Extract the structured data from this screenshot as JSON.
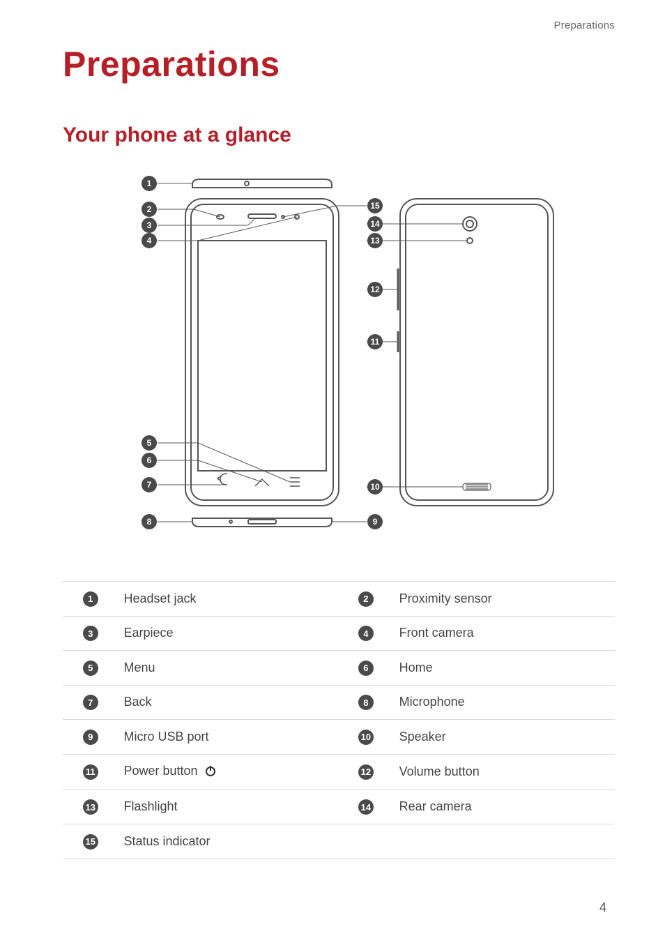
{
  "header_breadcrumb": "Preparations",
  "title": "Preparations",
  "subtitle": "Your phone at a glance",
  "page_number": "4",
  "legend": [
    {
      "n": "1",
      "label": "Headset jack"
    },
    {
      "n": "2",
      "label": "Proximity sensor"
    },
    {
      "n": "3",
      "label": "Earpiece"
    },
    {
      "n": "4",
      "label": "Front camera"
    },
    {
      "n": "5",
      "label": "Menu"
    },
    {
      "n": "6",
      "label": "Home"
    },
    {
      "n": "7",
      "label": "Back"
    },
    {
      "n": "8",
      "label": "Microphone"
    },
    {
      "n": "9",
      "label": "Micro USB port"
    },
    {
      "n": "10",
      "label": "Speaker"
    },
    {
      "n": "11",
      "label": "Power button "
    },
    {
      "n": "12",
      "label": "Volume button"
    },
    {
      "n": "13",
      "label": "Flashlight"
    },
    {
      "n": "14",
      "label": "Rear camera"
    },
    {
      "n": "15",
      "label": "Status indicator"
    }
  ],
  "callouts": {
    "front_left": [
      "1",
      "2",
      "3",
      "4",
      "5",
      "6",
      "7",
      "8"
    ],
    "mid_right": [
      "15",
      "14",
      "13",
      "12",
      "11",
      "10",
      "9"
    ]
  },
  "icons": {
    "power": "power-icon"
  }
}
